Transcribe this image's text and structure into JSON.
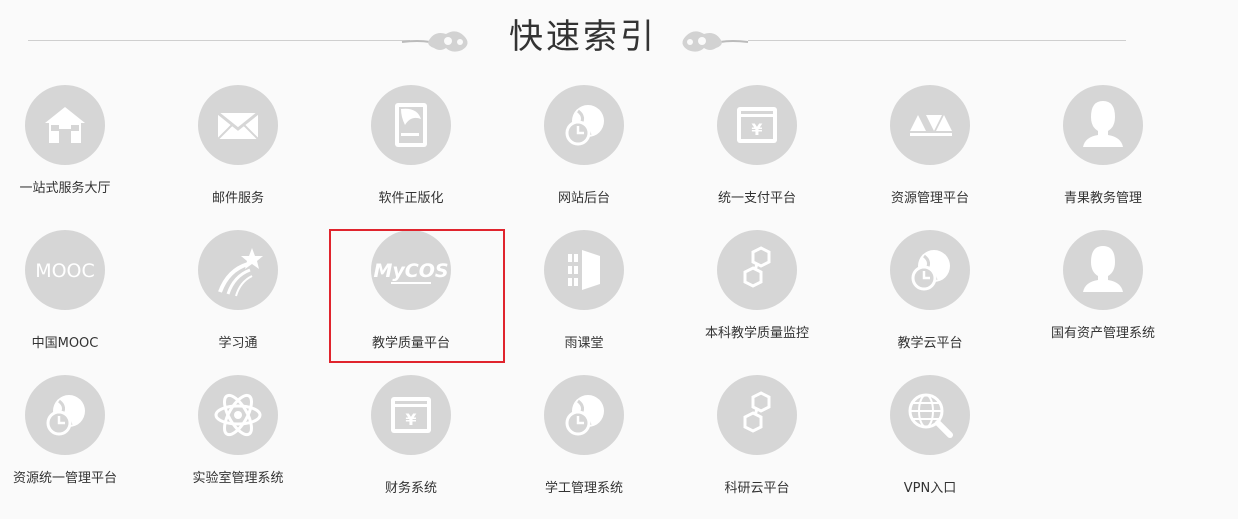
{
  "header": {
    "title": "快速索引"
  },
  "rows": [
    [
      {
        "label": "一站式服务大厅",
        "icon": "house-icon"
      },
      {
        "label": "邮件服务",
        "icon": "envelope-icon"
      },
      {
        "label": "软件正版化",
        "icon": "software-icon"
      },
      {
        "label": "网站后台",
        "icon": "globe-clock-icon"
      },
      {
        "label": "统一支付平台",
        "icon": "yen-wallet-icon"
      },
      {
        "label": "资源管理平台",
        "icon": "ava-logo-icon"
      },
      {
        "label": "青果教务管理",
        "icon": "user-silhouette-icon"
      }
    ],
    [
      {
        "label": "中国MOOC",
        "icon": "mooc-text-icon",
        "text": "MOOC"
      },
      {
        "label": "学习通",
        "icon": "shooting-star-icon"
      },
      {
        "label": "教学质量平台",
        "icon": "mycos-logo-icon",
        "text": "MyCOS"
      },
      {
        "label": "雨课堂",
        "icon": "rain-classroom-icon"
      },
      {
        "label": "本科教学质量监控",
        "icon": "hexagon-chain-icon"
      },
      {
        "label": "教学云平台",
        "icon": "globe-clock-icon"
      },
      {
        "label": "国有资产管理系统",
        "icon": "user-silhouette-icon"
      }
    ],
    [
      {
        "label": "资源统一管理平台",
        "icon": "globe-clock-icon"
      },
      {
        "label": "实验室管理系统",
        "icon": "atom-icon"
      },
      {
        "label": "财务系统",
        "icon": "yen-wallet-icon"
      },
      {
        "label": "学工管理系统",
        "icon": "globe-clock-icon"
      },
      {
        "label": "科研云平台",
        "icon": "hexagon-chain-icon"
      },
      {
        "label": "VPN入口",
        "icon": "globe-search-icon"
      }
    ]
  ],
  "selected": "教学质量平台",
  "colors": {
    "highlight_border": "#e0242d",
    "icon_bg": "#d6d6d6",
    "icon_fg": "#ffffff"
  }
}
